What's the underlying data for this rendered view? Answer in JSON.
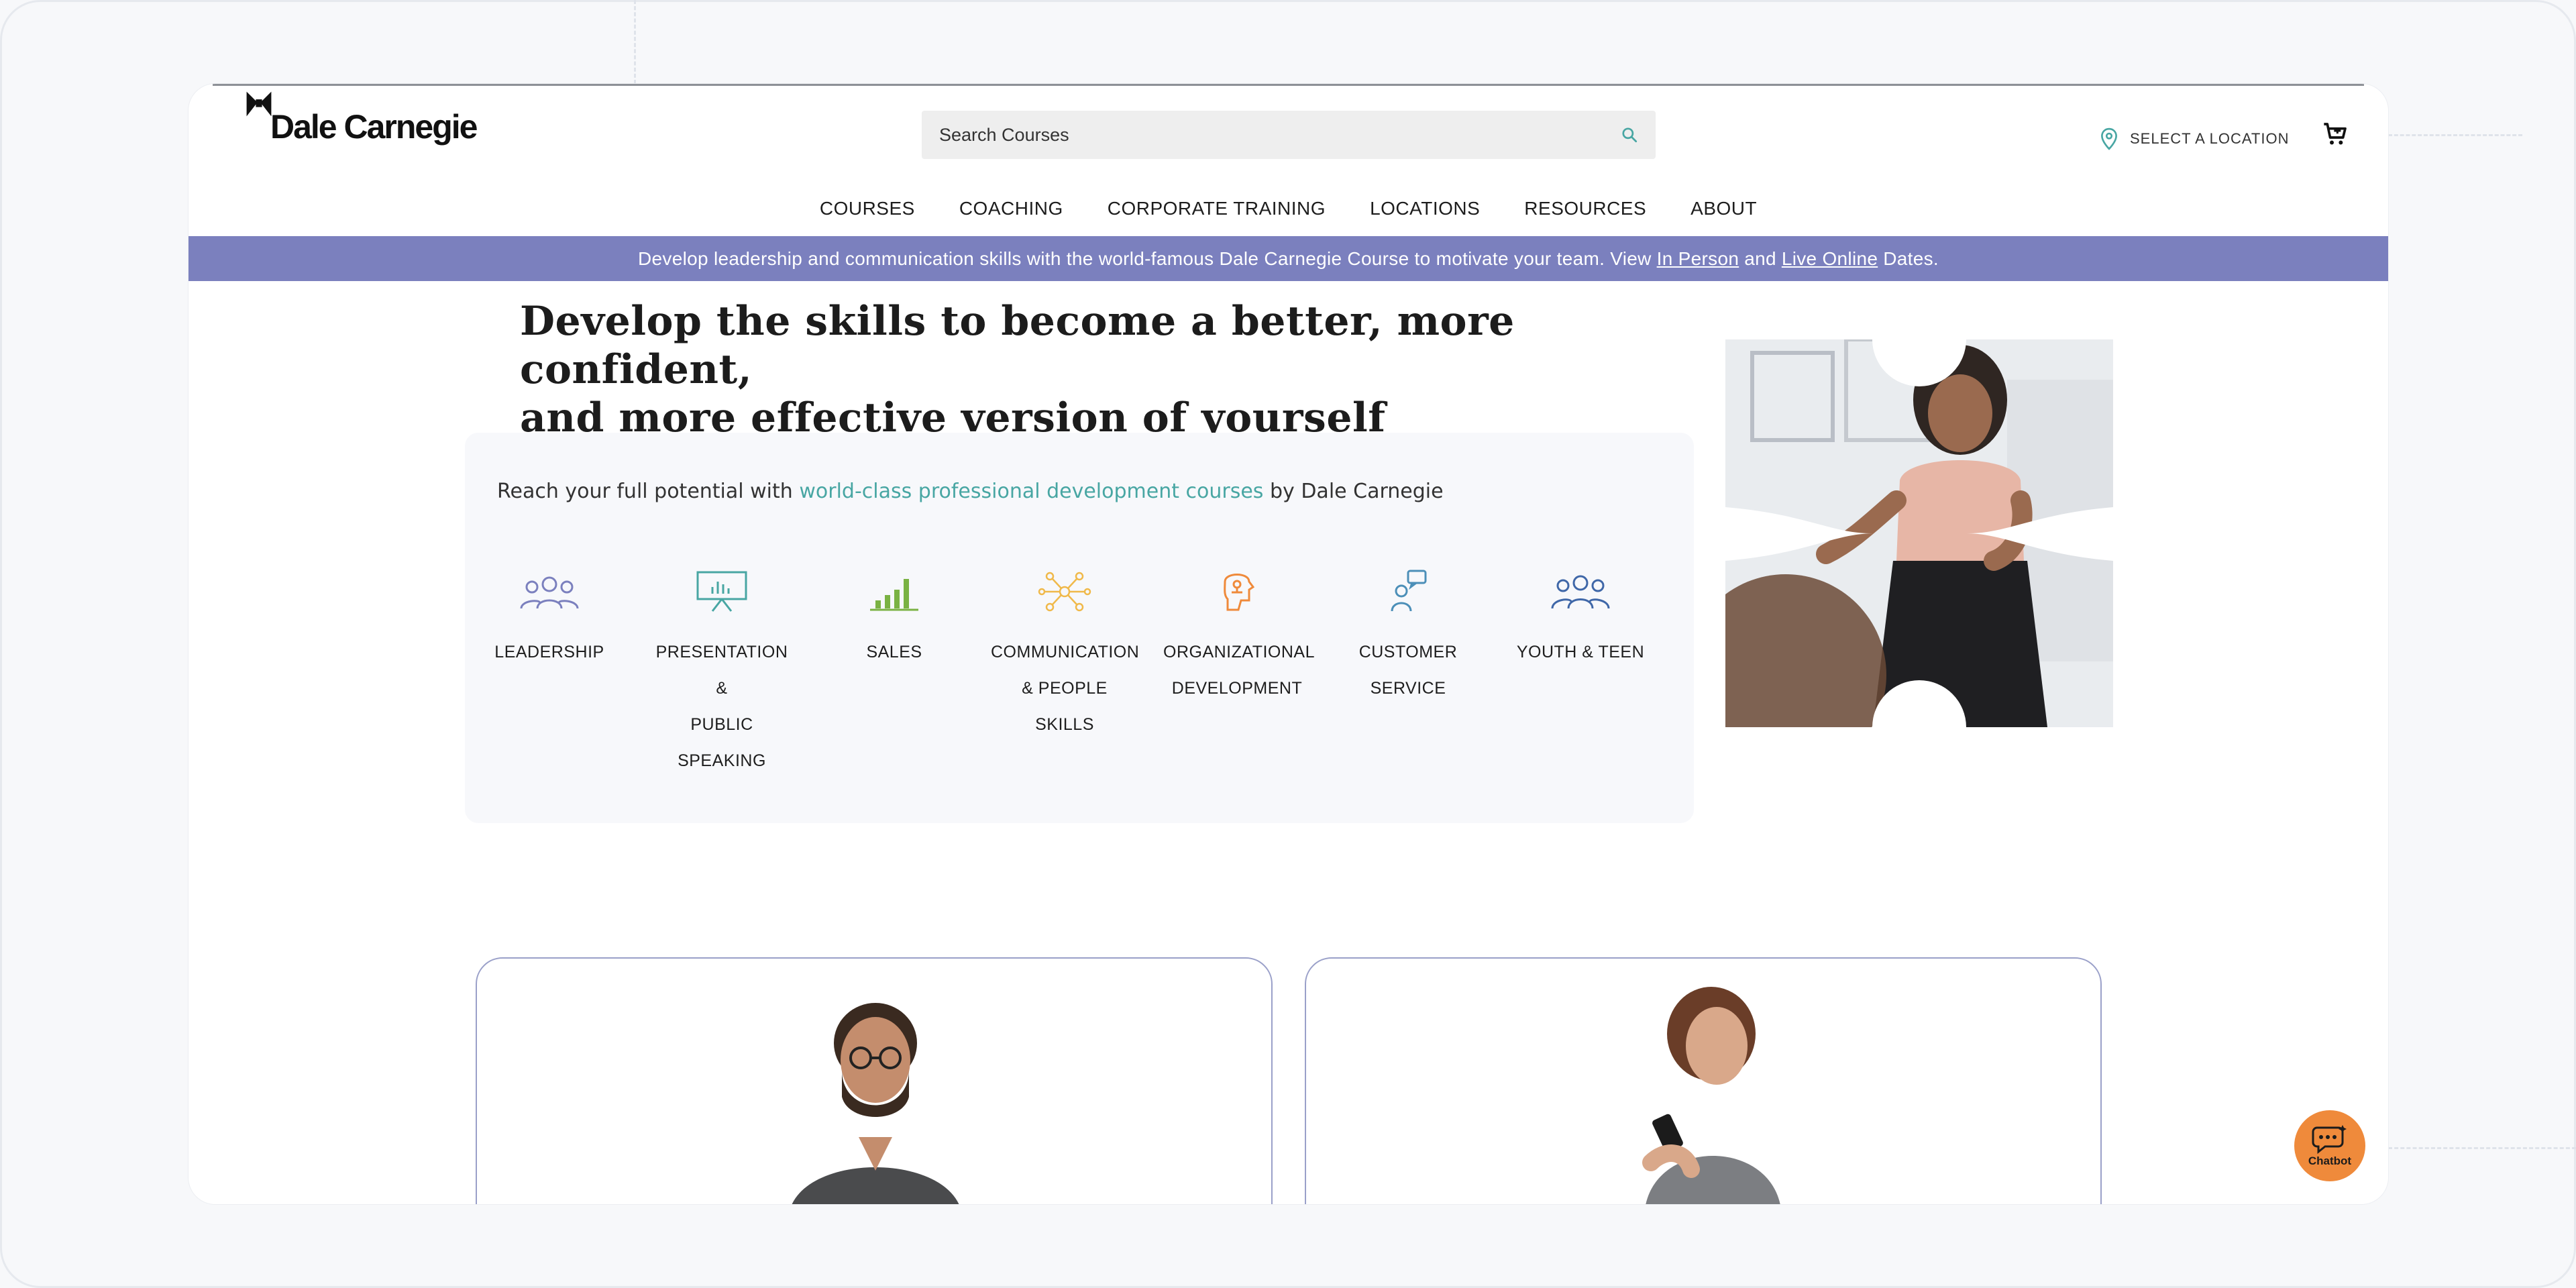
{
  "header": {
    "logo_text": "Dale Carnegie",
    "search_placeholder": "Search Courses",
    "location_label": "SELECT A LOCATION"
  },
  "nav": {
    "items": [
      "COURSES",
      "COACHING",
      "CORPORATE TRAINING",
      "LOCATIONS",
      "RESOURCES",
      "ABOUT"
    ]
  },
  "banner": {
    "text_before": "Develop leadership and communication skills with the world-famous Dale Carnegie Course to motivate your team. View",
    "link_in_person": "In Person",
    "text_and": "and",
    "link_live_online": "Live Online",
    "text_after": "Dates."
  },
  "hero": {
    "headline_line1": "Develop the skills to become a better, more confident,",
    "headline_line2": "and more effective version of yourself",
    "reach_before": "Reach your full potential with",
    "reach_link": "world-class professional development courses",
    "reach_after": "by Dale Carnegie"
  },
  "categories": [
    {
      "lines": [
        "LEADERSHIP"
      ],
      "icon": "people-group-icon",
      "color": "#7b80be"
    },
    {
      "lines": [
        "PRESENTATION",
        "&",
        "PUBLIC",
        "SPEAKING"
      ],
      "icon": "presentation-board-icon",
      "color": "#48a6a3"
    },
    {
      "lines": [
        "SALES"
      ],
      "icon": "bar-chart-icon",
      "color": "#7ab243"
    },
    {
      "lines": [
        "COMMUNICATION",
        "& PEOPLE",
        "SKILLS"
      ],
      "icon": "network-icon",
      "color": "#f0b94a"
    },
    {
      "lines": [
        "ORGANIZATIONAL",
        "DEVELOPMENT"
      ],
      "icon": "org-head-icon",
      "color": "#ef8a3b"
    },
    {
      "lines": [
        "CUSTOMER",
        "SERVICE"
      ],
      "icon": "customer-chat-icon",
      "color": "#4c8fb8"
    },
    {
      "lines": [
        "YOUTH & TEEN"
      ],
      "icon": "youth-group-icon",
      "color": "#3f67a8"
    }
  ],
  "chatbot": {
    "label": "Chatbot"
  },
  "colors": {
    "banner": "#7b80be",
    "accent_link": "#48a6a3",
    "chatbot": "#ef8a3b"
  }
}
